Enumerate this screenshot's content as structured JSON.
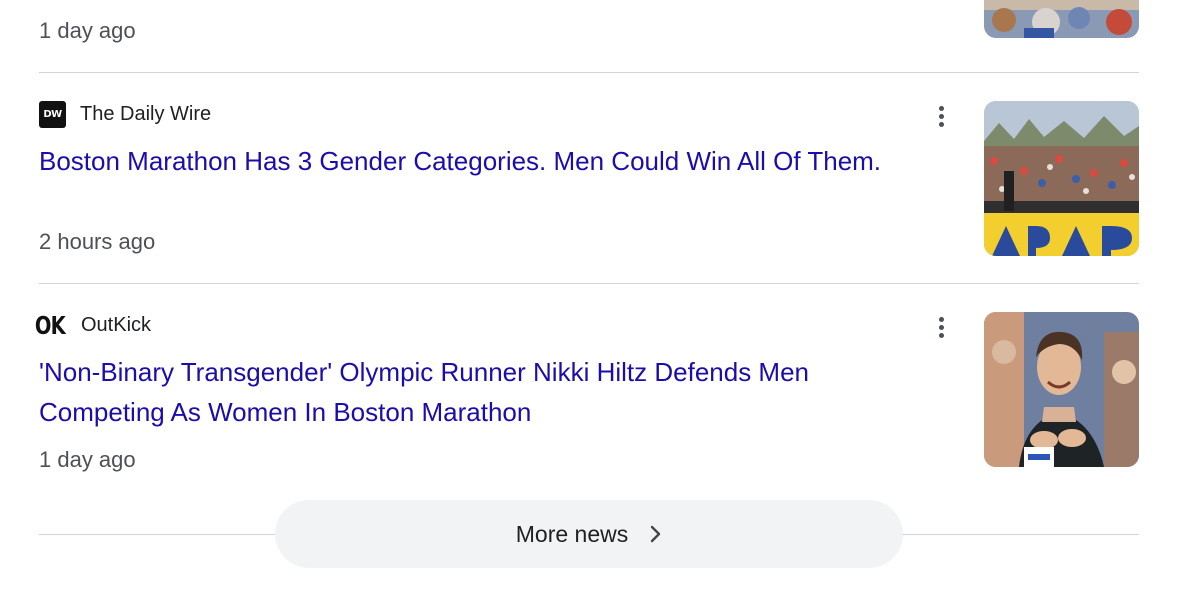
{
  "top_item": {
    "timestamp": "1 day ago",
    "icon": "news-thumbnail-image"
  },
  "articles": [
    {
      "source": "The Daily Wire",
      "source_logo_text": "DW",
      "headline": "Boston Marathon Has 3 Gender Categories. Men Could Win All Of Them.",
      "timestamp": "2 hours ago",
      "thumbnail": "boston-marathon-finish-crowd-image"
    },
    {
      "source": "OutKick",
      "source_logo_text": "OK",
      "headline": "'Non-Binary Transgender' Olympic Runner Nikki Hiltz Defends Men Competing As Women In Boston Marathon",
      "timestamp": "1 day ago",
      "thumbnail": "runner-celebrating-image"
    }
  ],
  "more_news": {
    "label": "More news",
    "icon": "chevron-right-icon"
  },
  "colors": {
    "link": "#1a0dab",
    "meta_text": "#4d5156",
    "divider": "#d2d4d8",
    "button_bg": "#f1f3f4"
  }
}
